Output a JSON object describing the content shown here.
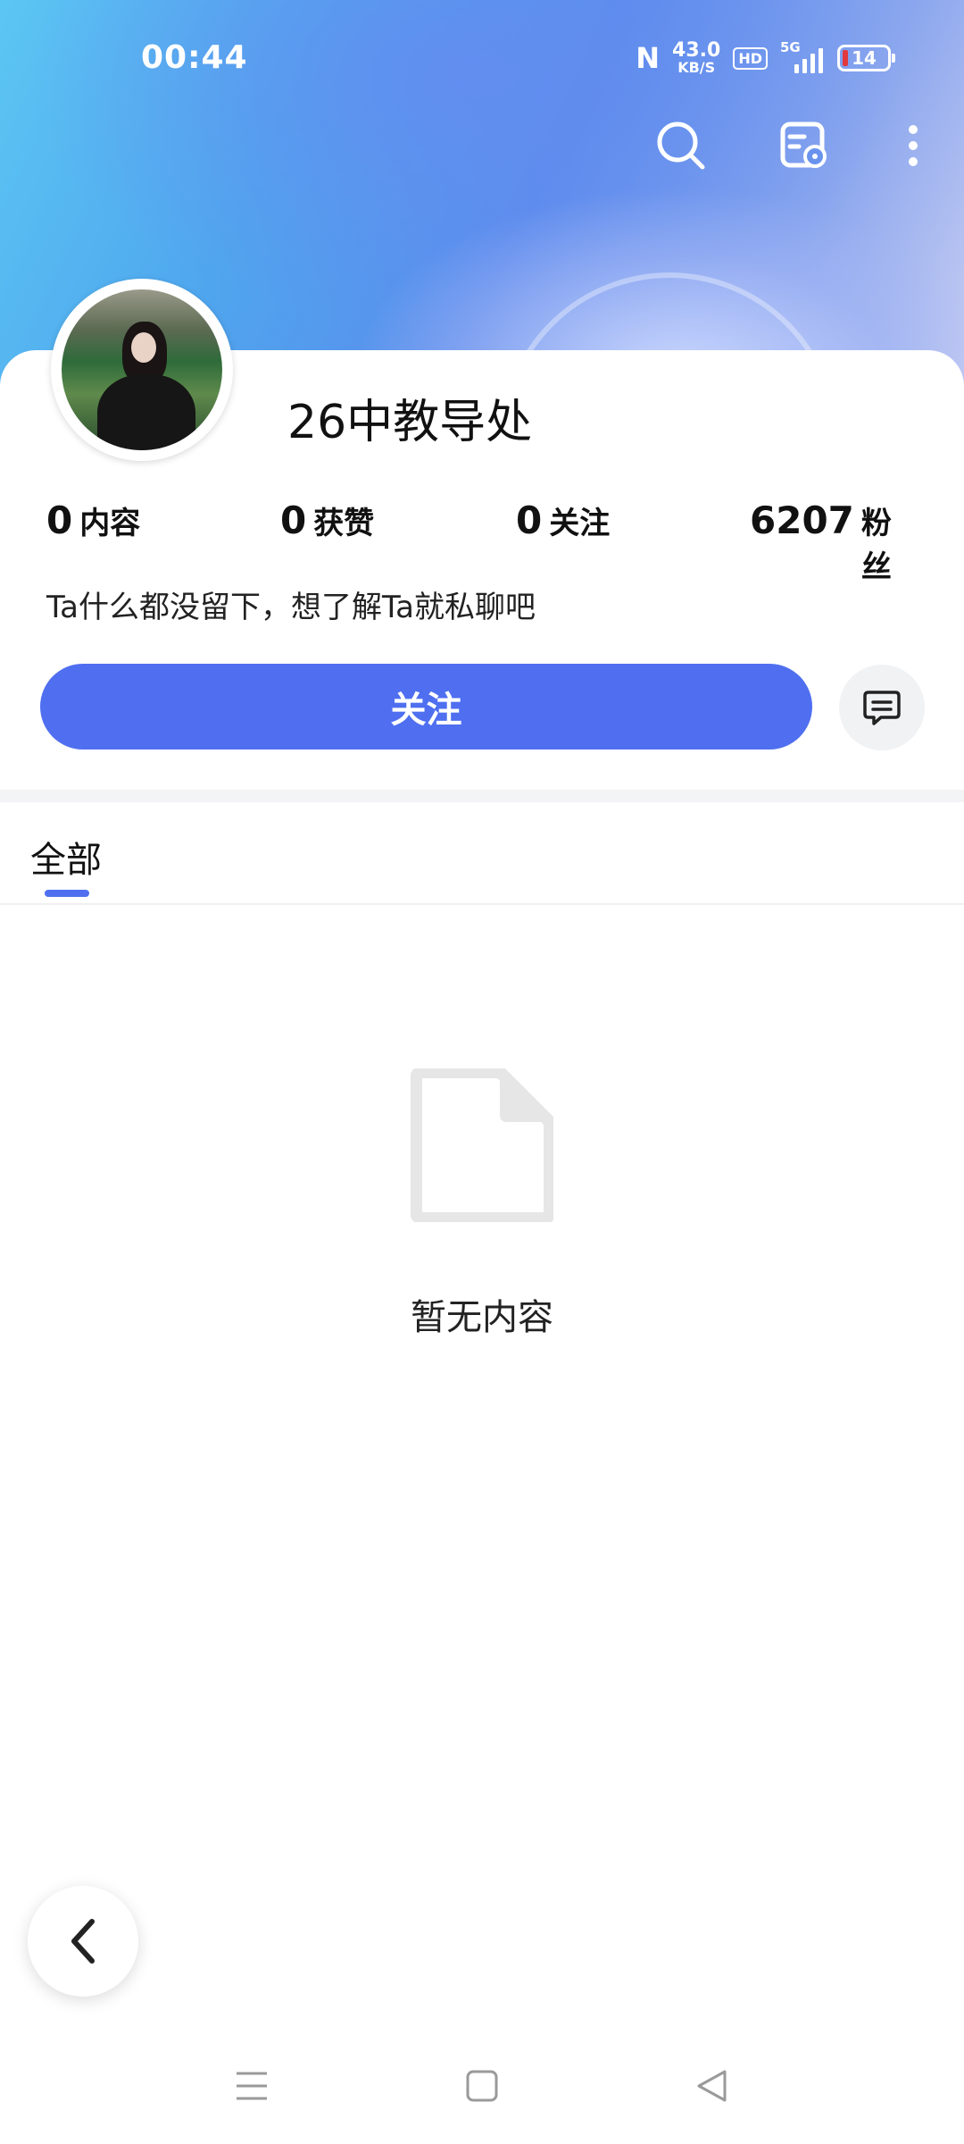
{
  "status_bar": {
    "time": "00:44",
    "nfc_icon": "nfc-icon",
    "network_speed_value": "43.0",
    "network_speed_unit": "KB/S",
    "hd_label": "HD",
    "network_type": "5G",
    "battery_level": "14"
  },
  "top_actions": {
    "search_icon": "search-icon",
    "share_icon": "profile-card-icon",
    "more_icon": "more-vertical-icon"
  },
  "profile": {
    "nickname": "26中教导处",
    "bio": "Ta什么都没留下，想了解Ta就私聊吧",
    "stats": [
      {
        "value": "0",
        "label": "内容"
      },
      {
        "value": "0",
        "label": "获赞"
      },
      {
        "value": "0",
        "label": "关注"
      },
      {
        "value": "6207",
        "label": "粉丝"
      }
    ]
  },
  "actions": {
    "follow_label": "关注",
    "message_icon": "chat-bubble-icon"
  },
  "tabs": [
    {
      "label": "全部",
      "active": true
    }
  ],
  "empty_state": {
    "icon": "document-icon",
    "text": "暂无内容"
  },
  "colors": {
    "accent": "#4f6ff0",
    "battery_low": "#e2393c"
  },
  "nav_bar": {
    "menu_icon": "menu-icon",
    "home_icon": "home-square-icon",
    "back_icon": "back-triangle-icon"
  }
}
